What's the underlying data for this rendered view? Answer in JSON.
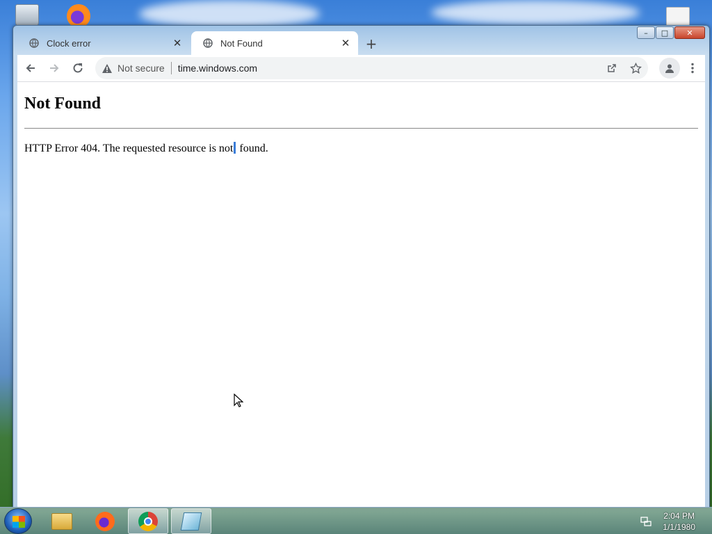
{
  "tabs": [
    {
      "title": "Clock error",
      "icon": "globe-icon",
      "active": false
    },
    {
      "title": "Not Found",
      "icon": "globe-icon",
      "active": true
    }
  ],
  "toolbar": {
    "security_label": "Not secure",
    "url": "time.windows.com"
  },
  "page": {
    "heading": "Not Found",
    "message_before_caret": "HTTP Error 404. The requested resource is not",
    "message_after_caret": " found."
  },
  "taskbar": {
    "items": [
      "file-explorer",
      "firefox",
      "chrome",
      "app"
    ],
    "active_item": "chrome",
    "time": "2:04 PM",
    "date": "1/1/1980"
  },
  "colors": {
    "caret": "#3b7dd8",
    "tab_active_bg": "#ffffff",
    "omnibox_bg": "#f1f3f4"
  }
}
